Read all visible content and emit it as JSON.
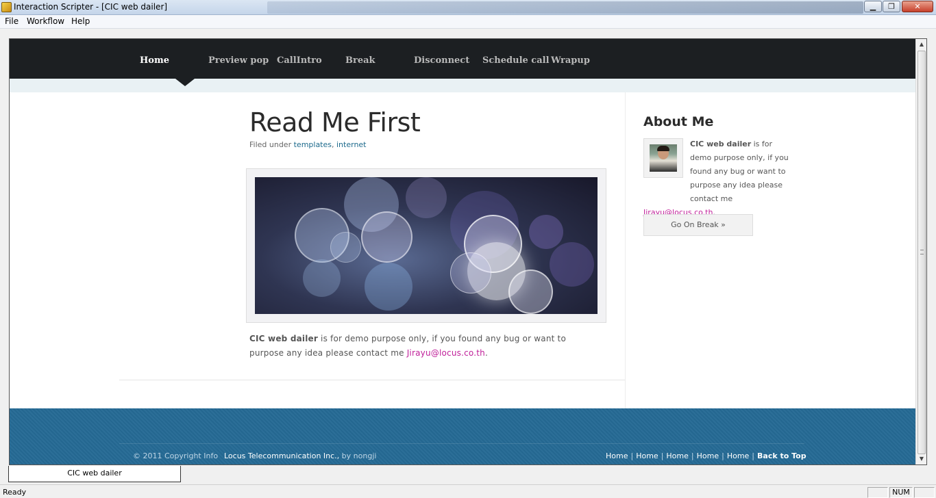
{
  "window": {
    "title": "Interaction Scripter - [CIC web dailer]",
    "min_label": "▁",
    "max_label": "❐",
    "close_label": "✕"
  },
  "menubar": {
    "items": [
      "File",
      "Workflow",
      "Help"
    ]
  },
  "site_nav": {
    "items": [
      "Home",
      "Preview pop",
      "CallIntro",
      "Break",
      "Disconnect",
      "Schedule call",
      "Wrapup"
    ],
    "active": "Home"
  },
  "post": {
    "title": "Read Me First",
    "filed_prefix": "Filed under ",
    "tags": [
      "templates",
      "internet"
    ],
    "tag_separator": ", ",
    "body_bold": "CIC web dailer",
    "body_text": " is for demo purpose only, if you found any bug or want to purpose any idea please contact me ",
    "body_email": "Jirayu@locus.co.th",
    "body_end": "."
  },
  "about": {
    "title": "About Me",
    "bold": "CIC web dailer",
    "text": " is for demo purpose only, if you found any bug or want to purpose any idea please contact me ",
    "email": "Jirayu@locus.co.th",
    "end": ".",
    "button_label": "Go On Break  »"
  },
  "footer": {
    "copyright": "© 2011 Copyright Info",
    "company": "Locus Telecommunication Inc.,",
    "by": " by nongji",
    "links": [
      "Home",
      "Home",
      "Home",
      "Home",
      "Home"
    ],
    "back_to_top": "Back to Top"
  },
  "document_tab": {
    "label": "CIC web dailer"
  },
  "statusbar": {
    "status": "Ready",
    "num_indicator": "NUM"
  },
  "colors": {
    "nav_bg": "#1c1f22",
    "footer_bg": "#256a95",
    "link": "#1d6a8c",
    "email": "#c0209a"
  }
}
